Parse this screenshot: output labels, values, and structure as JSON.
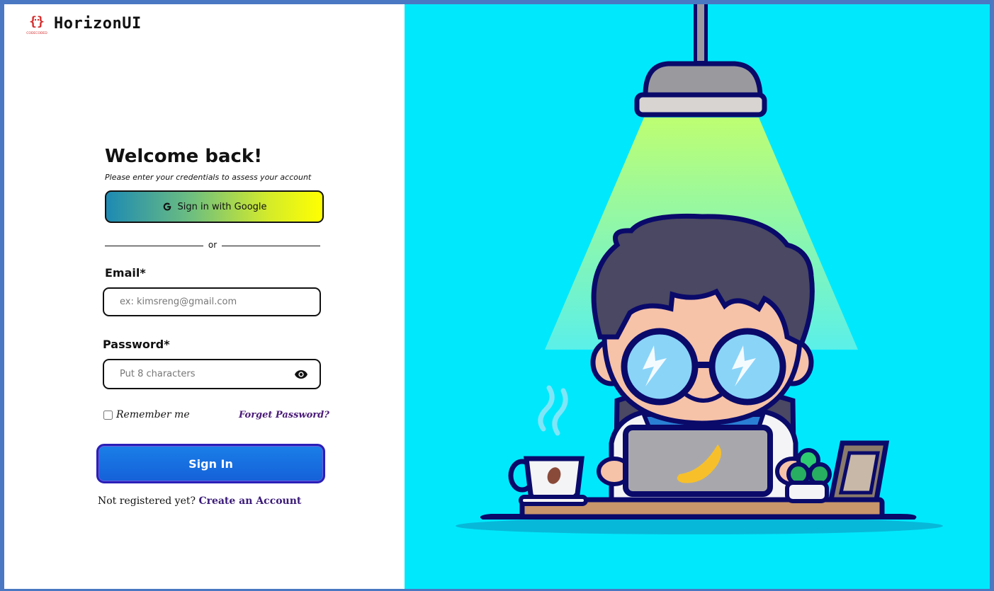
{
  "brand": {
    "name": "HorizonUI",
    "logo_text": "CODECODED",
    "logo_icon": "curly-braces-logo-icon"
  },
  "login": {
    "title": "Welcome back!",
    "subtitle": "Please enter your credentials to assess your account",
    "google_button_label": "Sign in with Google",
    "google_icon": "google-g-icon",
    "divider_text": "or",
    "email_label": "Email*",
    "email_placeholder": "ex: kimsreng@gmail.com",
    "password_label": "Password*",
    "password_placeholder": "Put 8 characters",
    "password_toggle_icon": "eye-icon",
    "remember_label": "Remember me",
    "remember_checked": false,
    "forgot_link": "Forget Password?",
    "sign_in_label": "Sign In",
    "register_prompt": "Not registered yet?",
    "register_link": "Create an Account"
  },
  "colors": {
    "frame_border": "#4a78c2",
    "illustration_bg": "#00e8fc",
    "sign_in_button": "#1a7fe8",
    "link": "#3a1a78",
    "google_gradient_start": "#1d8ab3",
    "google_gradient_end": "#ffff00"
  },
  "illustration": {
    "subject": "boy-with-glasses-working-on-laptop-under-lamp",
    "elements": [
      "ceiling-lamp-icon",
      "light-beam",
      "boy-character",
      "laptop-icon",
      "coffee-cup-icon",
      "plant-icon",
      "photo-frame-icon",
      "desk"
    ]
  }
}
